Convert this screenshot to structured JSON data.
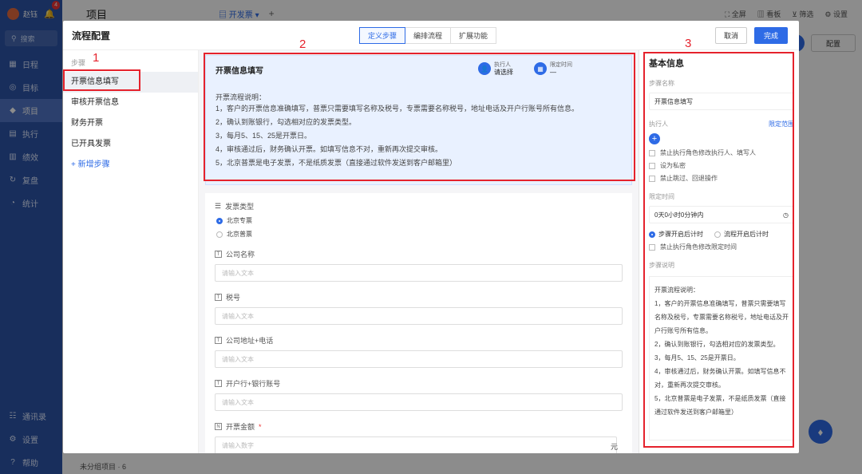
{
  "app": {
    "user": "赵钰",
    "badge": "4",
    "search": "搜索",
    "nav": [
      "日程",
      "目标",
      "项目",
      "执行",
      "绩效",
      "复盘",
      "统计"
    ],
    "nav_bottom": [
      "通讯录",
      "设置",
      "帮助"
    ],
    "page_title": "项目",
    "tab_dropdown": "开发票",
    "plus": "+",
    "tools": [
      "全屏",
      "看板",
      "筛选",
      "设置"
    ],
    "config_button": "配置",
    "bottom_group": "未分组项目 · 6"
  },
  "modal": {
    "title": "流程配置",
    "tabs": [
      "定义步骤",
      "编排流程",
      "扩展功能"
    ],
    "cancel": "取消",
    "done": "完成"
  },
  "steps": {
    "heading": "步骤",
    "items": [
      "开票信息填写",
      "审核开票信息",
      "财务开票",
      "已开具发票"
    ],
    "add": "+ 新增步骤"
  },
  "card": {
    "title": "开票信息填写",
    "executor_label": "执行人",
    "executor_value": "请选择",
    "deadline_label": "限定时间",
    "deadline_value": "—",
    "desc_title": "开票流程说明：",
    "desc_lines": [
      "1，客户的开票信息准确填写，普票只需要填写名称及税号，专票需要名称税号，地址电话及开户行账号所有信息。",
      "2，确认到账银行，勾选相对应的发票类型。",
      "3，每月5、15、25是开票日。",
      "4，审核通过后，财务确认开票。如填写信息不对，重新再次提交审核。",
      "5，北京普票是电子发票，不是纸质发票（直接通过软件发送到客户邮箱里）"
    ]
  },
  "form": {
    "invoice_type_label": "发票类型",
    "options": [
      "北京专票",
      "北京普票"
    ],
    "company_name_label": "公司名称",
    "tax_label": "税号",
    "address_label": "公司地址+电话",
    "bank_label": "开户行+银行账号",
    "amount_label": "开票金额",
    "req_mark": "*",
    "text_placeholder": "请输入文本",
    "number_placeholder": "请输入数字",
    "unit": "元"
  },
  "panel": {
    "title": "基本信息",
    "step_name_label": "步骤名称",
    "step_name_value": "开票信息填写",
    "executor_label": "执行人",
    "limit_range": "限定范围",
    "checks": [
      "禁止执行角色修改执行人、填写人",
      "设为私密",
      "禁止跳过、回退操作"
    ],
    "time_label": "限定时间",
    "time_value": "0天0小时0分钟内",
    "radio_a": "步骤开启后计时",
    "radio_b": "流程开启后计时",
    "time_check": "禁止执行角色修改限定时间",
    "desc_label": "步骤说明",
    "desc_text": "开票流程说明：\n1，客户的开票信息准确填写，普票只需要填写名称及税号，专票需要名称税号，地址电话及开户行账号所有信息。\n2，确认到账银行，勾选相对应的发票类型。\n3，每月5、15、25是开票日。\n4，审核通过后，财务确认开票。如填写信息不对，重新再次提交审核。\n5，北京普票是电子发票，不是纸质发票（直接通过软件发送到客户邮箱里）"
  },
  "annotations": [
    "1",
    "2",
    "3"
  ]
}
